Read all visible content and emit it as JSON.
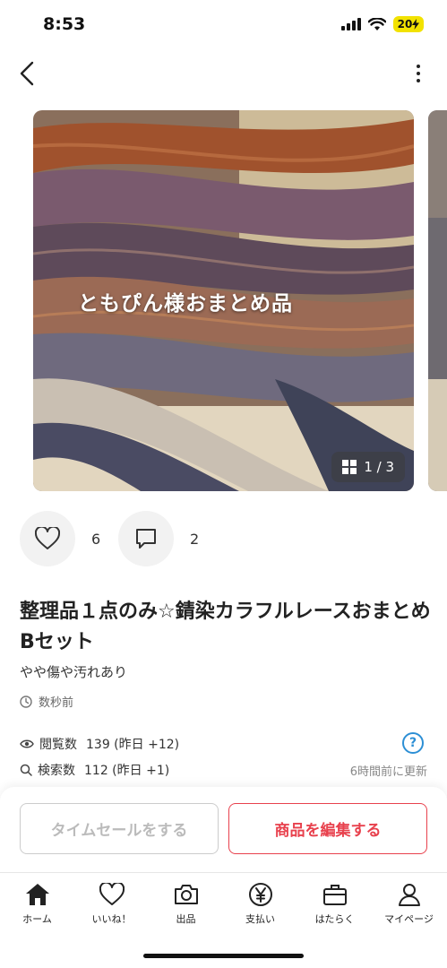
{
  "status_bar": {
    "time": "8:53",
    "battery": "20"
  },
  "product": {
    "photo_caption": "ともぴん様おまとめ品",
    "page_counter": "1 / 3",
    "likes_count": "6",
    "comments_count": "2",
    "title": "整理品１点のみ☆錆染カラフルレースおまとめBセット",
    "condition": "やや傷や汚れあり",
    "posted_time": "数秒前"
  },
  "stats": {
    "views_label": "閲覧数",
    "views_value": "139 (昨日 +12)",
    "search_label": "検索数",
    "search_value": "112 (昨日 +1)",
    "updated": "6時間前に更新",
    "help": "?"
  },
  "buttons": {
    "time_sale": "タイムセールをする",
    "edit": "商品を編集する"
  },
  "tabs": [
    {
      "label": "ホーム",
      "icon": "home-icon"
    },
    {
      "label": "いいね！",
      "icon": "heart-icon"
    },
    {
      "label": "出品",
      "icon": "camera-icon"
    },
    {
      "label": "支払い",
      "icon": "yen-icon"
    },
    {
      "label": "はたらく",
      "icon": "briefcase-icon"
    },
    {
      "label": "マイページ",
      "icon": "person-icon"
    }
  ],
  "colors": {
    "accent": "#e8414d",
    "info": "#2d8fd5"
  }
}
